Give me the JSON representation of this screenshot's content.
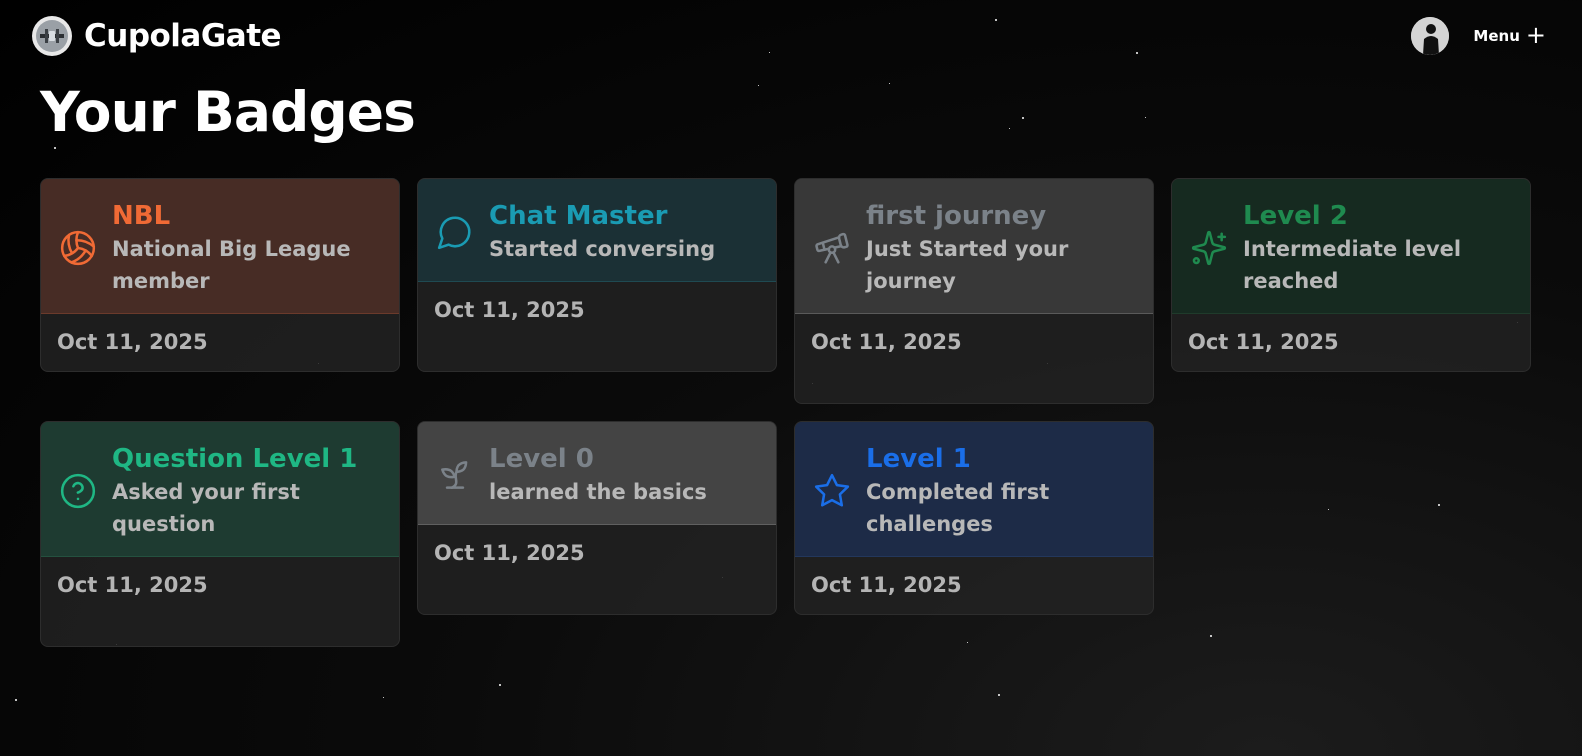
{
  "brand": {
    "name": "CupolaGate",
    "logo_icon": "space-station-icon"
  },
  "nav": {
    "menu_label": "Menu",
    "menu_icon": "plus-icon",
    "avatar_icon": "user-avatar-icon"
  },
  "page_title": "Your Badges",
  "badges": [
    {
      "title": "NBL",
      "description": "National Big League member",
      "date": "Oct 11, 2025",
      "icon": "volleyball-icon",
      "color": "#f06a35",
      "bg": "#472c25",
      "border": "#6b3a2b"
    },
    {
      "title": "Chat Master",
      "description": "Started conversing",
      "date": "Oct 11, 2025",
      "icon": "chat-bubble-icon",
      "color": "#1a9bb3",
      "bg": "#1b3035",
      "border": "#1f4a52"
    },
    {
      "title": "first journey",
      "description": "Just Started your journey",
      "date": "Oct 11, 2025",
      "icon": "telescope-icon",
      "color": "#7b8289",
      "bg": "#383838",
      "border": "#5a5a5a"
    },
    {
      "title": "Level 2",
      "description": "Intermediate level reached",
      "date": "Oct 11, 2025",
      "icon": "sparkles-icon",
      "color": "#1f8a4f",
      "bg": "#162a20",
      "border": "#1f3b2b"
    },
    {
      "title": "Question Level 1",
      "description": "Asked your first question",
      "date": "Oct 11, 2025",
      "icon": "question-circle-icon",
      "color": "#1fb784",
      "bg": "#1e3b31",
      "border": "#24513f"
    },
    {
      "title": "Level 0",
      "description": "learned the basics",
      "date": "Oct 11, 2025",
      "icon": "sprout-icon",
      "color": "#7b8289",
      "bg": "#444444",
      "border": "#606060"
    },
    {
      "title": "Level 1",
      "description": "Completed first challenges",
      "date": "Oct 11, 2025",
      "icon": "star-icon",
      "color": "#1a6ee8",
      "bg": "#1d2b47",
      "border": "#23375c"
    }
  ]
}
